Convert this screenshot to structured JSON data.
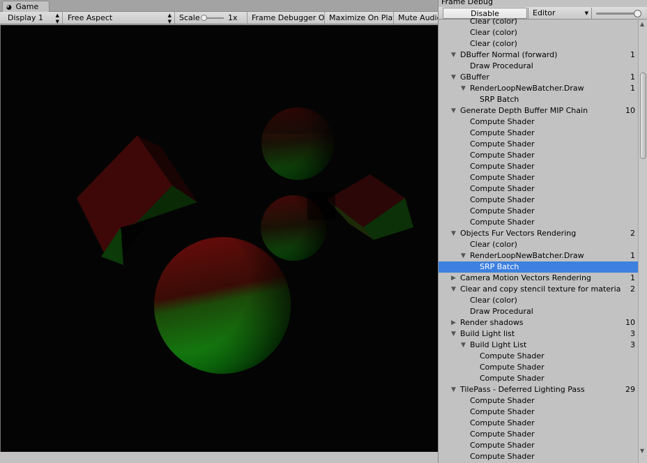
{
  "game": {
    "tab_label": "Game",
    "tab_icon": "gamepad-icon",
    "toolbar": {
      "display": "Display 1",
      "aspect": "Free Aspect",
      "scale_label": "Scale",
      "scale_value": "1x",
      "frame_debugger": "Frame Debugger On",
      "maximize": "Maximize On Play",
      "mute": "Mute Audio"
    }
  },
  "frame_debug": {
    "title": "Frame Debug",
    "disable_button": "Disable",
    "target": "Editor",
    "rows": [
      {
        "label": "Clear (color)",
        "level": 2,
        "fold": "",
        "count": ""
      },
      {
        "label": "Clear (color)",
        "level": 2,
        "fold": "",
        "count": ""
      },
      {
        "label": "Clear (color)",
        "level": 2,
        "fold": "",
        "count": ""
      },
      {
        "label": "DBuffer Normal (forward)",
        "level": 1,
        "fold": "open",
        "count": "1"
      },
      {
        "label": "Draw Procedural",
        "level": 2,
        "fold": "",
        "count": ""
      },
      {
        "label": "GBuffer",
        "level": 1,
        "fold": "open",
        "count": "1"
      },
      {
        "label": "RenderLoopNewBatcher.Draw",
        "level": 2,
        "fold": "open",
        "count": "1"
      },
      {
        "label": "SRP Batch",
        "level": 3,
        "fold": "",
        "count": ""
      },
      {
        "label": "Generate Depth Buffer MIP Chain",
        "level": 1,
        "fold": "open",
        "count": "10"
      },
      {
        "label": "Compute Shader",
        "level": 2,
        "fold": "",
        "count": ""
      },
      {
        "label": "Compute Shader",
        "level": 2,
        "fold": "",
        "count": ""
      },
      {
        "label": "Compute Shader",
        "level": 2,
        "fold": "",
        "count": ""
      },
      {
        "label": "Compute Shader",
        "level": 2,
        "fold": "",
        "count": ""
      },
      {
        "label": "Compute Shader",
        "level": 2,
        "fold": "",
        "count": ""
      },
      {
        "label": "Compute Shader",
        "level": 2,
        "fold": "",
        "count": ""
      },
      {
        "label": "Compute Shader",
        "level": 2,
        "fold": "",
        "count": ""
      },
      {
        "label": "Compute Shader",
        "level": 2,
        "fold": "",
        "count": ""
      },
      {
        "label": "Compute Shader",
        "level": 2,
        "fold": "",
        "count": ""
      },
      {
        "label": "Compute Shader",
        "level": 2,
        "fold": "",
        "count": ""
      },
      {
        "label": "Objects Fur Vectors Rendering",
        "level": 1,
        "fold": "open",
        "count": "2"
      },
      {
        "label": "Clear (color)",
        "level": 2,
        "fold": "",
        "count": ""
      },
      {
        "label": "RenderLoopNewBatcher.Draw",
        "level": 2,
        "fold": "open",
        "count": "1"
      },
      {
        "label": "SRP Batch",
        "level": 3,
        "fold": "",
        "count": "",
        "selected": true
      },
      {
        "label": "Camera Motion Vectors Rendering",
        "level": 1,
        "fold": "closed",
        "count": "1"
      },
      {
        "label": "Clear and copy stencil texture for materia",
        "level": 1,
        "fold": "open",
        "count": "2"
      },
      {
        "label": "Clear (color)",
        "level": 2,
        "fold": "",
        "count": ""
      },
      {
        "label": "Draw Procedural",
        "level": 2,
        "fold": "",
        "count": ""
      },
      {
        "label": "Render shadows",
        "level": 1,
        "fold": "closed",
        "count": "10"
      },
      {
        "label": "Build Light list",
        "level": 1,
        "fold": "open",
        "count": "3"
      },
      {
        "label": "Build Light List",
        "level": 2,
        "fold": "open",
        "count": "3"
      },
      {
        "label": "Compute Shader",
        "level": 3,
        "fold": "",
        "count": ""
      },
      {
        "label": "Compute Shader",
        "level": 3,
        "fold": "",
        "count": ""
      },
      {
        "label": "Compute Shader",
        "level": 3,
        "fold": "",
        "count": ""
      },
      {
        "label": "TilePass - Deferred Lighting Pass",
        "level": 1,
        "fold": "open",
        "count": "29"
      },
      {
        "label": "Compute Shader",
        "level": 2,
        "fold": "",
        "count": ""
      },
      {
        "label": "Compute Shader",
        "level": 2,
        "fold": "",
        "count": ""
      },
      {
        "label": "Compute Shader",
        "level": 2,
        "fold": "",
        "count": ""
      },
      {
        "label": "Compute Shader",
        "level": 2,
        "fold": "",
        "count": ""
      },
      {
        "label": "Compute Shader",
        "level": 2,
        "fold": "",
        "count": ""
      },
      {
        "label": "Compute Shader",
        "level": 2,
        "fold": "",
        "count": ""
      }
    ]
  }
}
